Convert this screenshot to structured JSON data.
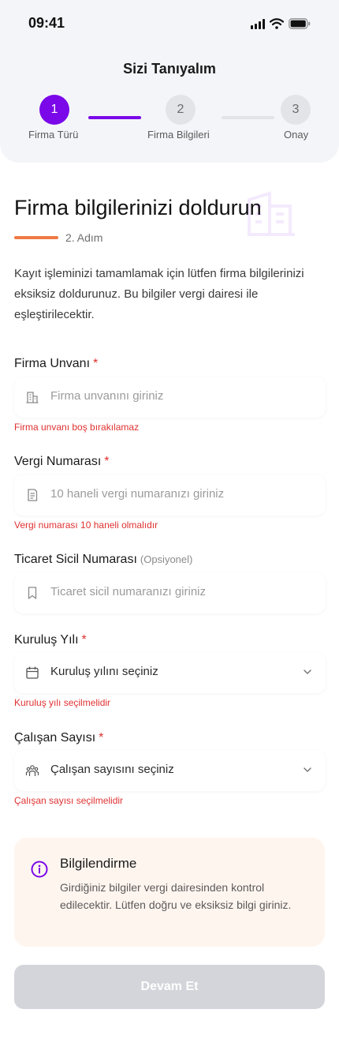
{
  "status_bar": {
    "time": "09:41",
    "icons": [
      "signal-icon",
      "wifi-icon",
      "battery-icon"
    ]
  },
  "header": {
    "title": "Sizi Tanıyalım"
  },
  "stepper": {
    "steps": [
      {
        "number": "1",
        "label": "Firma Türü",
        "state": "active"
      },
      {
        "number": "2",
        "label": "Firma Bilgileri",
        "state": "current-pending"
      },
      {
        "number": "3",
        "label": "Onay",
        "state": "pending"
      }
    ],
    "colors": {
      "active": "#7a08e8",
      "idle": "#e3e4e8"
    }
  },
  "main": {
    "heading": "Firma bilgilerinizi doldurun",
    "step_text": "2. Adım",
    "intro": "Kayıt işleminizi tamamlamak için lütfen firma bilgilerinizi eksiksiz doldurunuz. Bu bilgiler vergi dairesi ile eşleştirilecektir.",
    "accent_color": "#ef7a45"
  },
  "form": {
    "company_name": {
      "label": "Firma Unvanı",
      "required": "*",
      "placeholder": "Firma unvanını giriniz",
      "error": "Firma unvanı boş bırakılamaz",
      "icon": "building-icon"
    },
    "tax_number": {
      "label": "Vergi Numarası",
      "required": "*",
      "placeholder": "10 haneli vergi numaranızı giriniz",
      "error": "Vergi numarası 10 haneli olmalıdır",
      "icon": "document-icon"
    },
    "trade_registry": {
      "label": "Ticaret Sicil Numarası",
      "optional": "(Opsiyonel)",
      "placeholder": "Ticaret sicil numaranızı giriniz",
      "icon": "bookmark-icon"
    },
    "founding_year": {
      "label": "Kuruluş Yılı",
      "required": "*",
      "value": "Kuruluş yılını seçiniz",
      "error": "Kuruluş yılı seçilmelidir",
      "icon": "calendar-icon"
    },
    "employee_count": {
      "label": "Çalışan Sayısı",
      "required": "*",
      "value": "Çalışan sayısını seçiniz",
      "error": "Çalışan sayısı seçilmelidir",
      "icon": "people-icon"
    },
    "error_color": "#e03131"
  },
  "info_box": {
    "title": "Bilgilendirme",
    "text": "Girdiğiniz bilgiler vergi dairesinden kontrol edilecektir. Lütfen doğru ve eksiksiz bilgi giriniz.",
    "icon": "info-icon"
  },
  "cta": {
    "label": "Devam Et",
    "state": "disabled"
  }
}
